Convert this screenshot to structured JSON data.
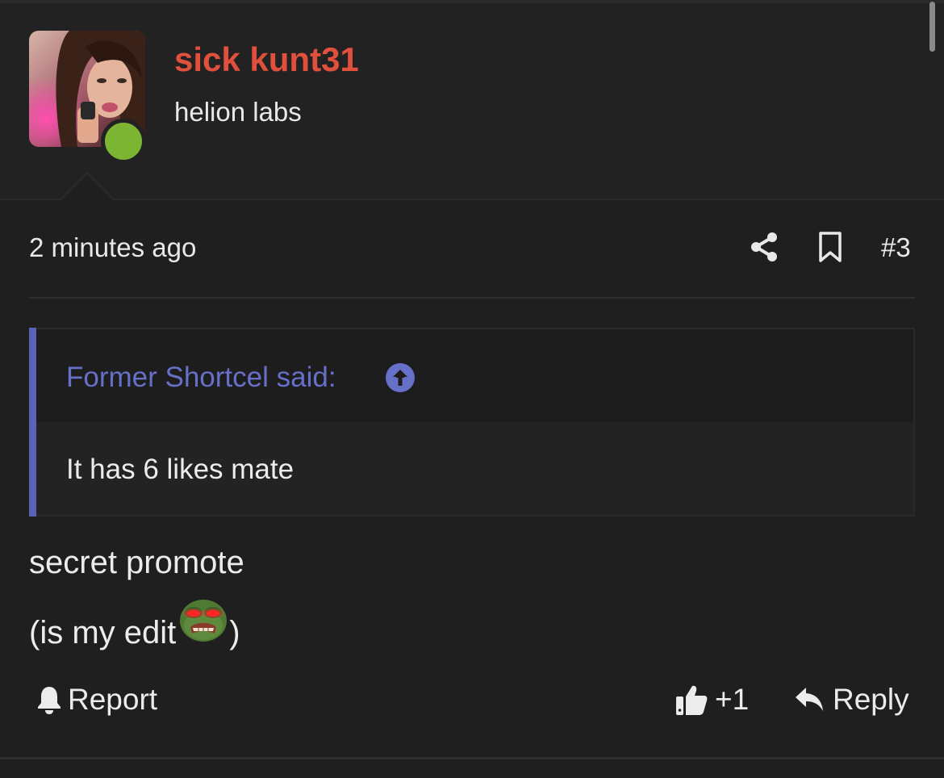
{
  "post": {
    "username": "sick kunt31",
    "user_title": "helion labs",
    "online": true,
    "timestamp": "2 minutes ago",
    "post_number": "#3",
    "quote": {
      "author_label": "Former Shortcel said:",
      "text": "It has 6 likes mate"
    },
    "message": {
      "line1": "secret promote",
      "line2_prefix": "(is my edit",
      "line2_suffix": ")"
    },
    "actions": {
      "report_label": "Report",
      "like_label": "+1",
      "reply_label": "Reply"
    }
  },
  "colors": {
    "background": "#1f1f1f",
    "username": "#e0503d",
    "quote_accent": "#5a63b8",
    "quote_author": "#6670c9",
    "online": "#7cb532"
  },
  "icons": {
    "share": "share-icon",
    "bookmark": "bookmark-icon",
    "quote_jump": "arrow-up-circle-icon",
    "report": "bell-icon",
    "like": "thumbs-up-icon",
    "reply": "reply-arrow-icon",
    "emoji": "angry-frog-emoji"
  }
}
